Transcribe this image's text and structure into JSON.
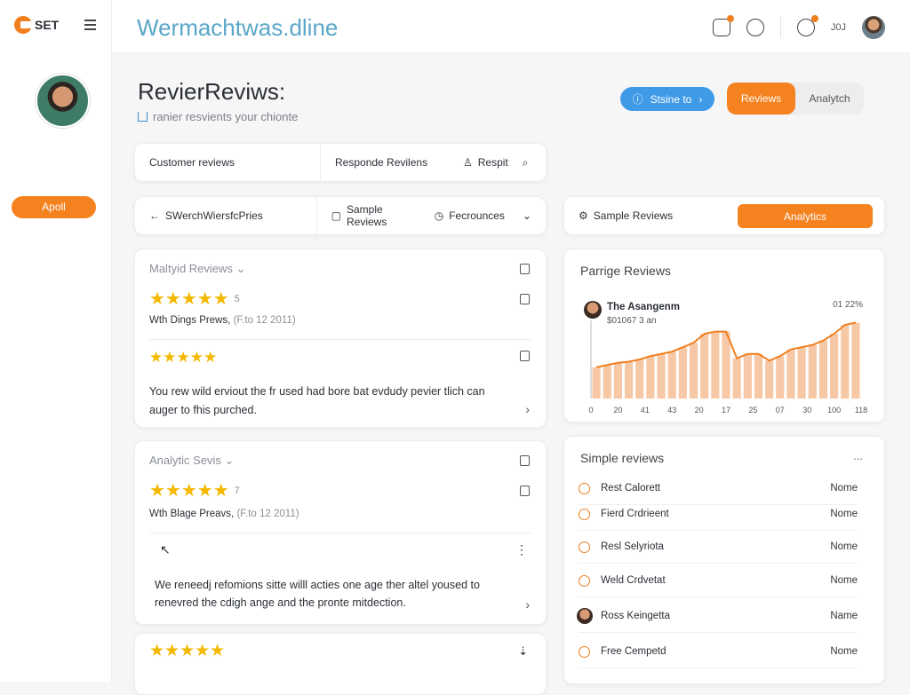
{
  "brand": {
    "logo_text": "SET",
    "site_title": "Wermachtwas.dline"
  },
  "topbar": {
    "user_label": "J0J",
    "icons": [
      "clipboard-icon",
      "link-icon",
      "chat-icon"
    ]
  },
  "sidebar": {
    "button_label": "Apoll"
  },
  "page": {
    "title": "RevierReviws:",
    "subtitle": "ranier resvients your chionte"
  },
  "actions": {
    "primary_pill": "Stsine to",
    "seg_on": "Reviews",
    "seg_off": "Analytch"
  },
  "toolbar1": {
    "a": "Customer reviews",
    "b": "Responde Revilens",
    "c": "Respit"
  },
  "toolbar2": {
    "a": "SWerchWiersfcPries",
    "b": "Sample Reviews",
    "c": "Fecrounces"
  },
  "toolbar3": {
    "a": "Sample Reviews",
    "btn": "Analytics"
  },
  "review1": {
    "heading": "Maltyid Reviews",
    "rating": "5",
    "meta_name": "Wth Dings Prews,",
    "meta_date": "(F.to 12 2011)",
    "body": "You rew wild erviout the fr used had bore bat evdudy pevier tlich can auger to fhis purched."
  },
  "review2": {
    "heading": "Analytic Sevis",
    "rating": "7",
    "meta_name": "Wth Blage Preavs,",
    "meta_date": "(F.to 12 2011)",
    "body": "We reneedj refomions sitte willl acties one age ther altel yoused to renevred the cdigh ange and the pronte mitdection."
  },
  "chart_card": {
    "title": "Parrige Reviews",
    "person": "The Asangenm",
    "figure": "$01067 3 an",
    "corner": "01 22%"
  },
  "chart_data": {
    "type": "bar",
    "title": "Parrige Reviews",
    "x_tick_labels": [
      "0",
      "20",
      "41",
      "43",
      "20",
      "17",
      "25",
      "07",
      "30",
      "100",
      "118"
    ],
    "values": [
      28,
      30,
      32,
      33,
      35,
      38,
      40,
      42,
      46,
      50,
      58,
      60,
      60,
      36,
      40,
      40,
      34,
      38,
      44,
      46,
      48,
      52,
      58,
      66,
      68
    ],
    "line_values": [
      28,
      30,
      32,
      33,
      35,
      38,
      40,
      42,
      46,
      50,
      58,
      60,
      60,
      36,
      40,
      40,
      34,
      38,
      44,
      46,
      48,
      52,
      58,
      66,
      68
    ],
    "colors": {
      "bar": "#f7c8a5",
      "line": "#f07f1f"
    }
  },
  "list": {
    "title": "Simple reviews",
    "more": "...",
    "items": [
      {
        "name": "Rest Calorett",
        "status": "Nome",
        "avatar": false
      },
      {
        "name": "Fierd Crdrieent",
        "status": "Nome",
        "avatar": false
      },
      {
        "name": "Resl Selyriota",
        "status": "Nome",
        "avatar": false
      },
      {
        "name": "Weld Crdvetat",
        "status": "Nome",
        "avatar": false
      },
      {
        "name": "Ross Keingetta",
        "status": "Name",
        "avatar": true
      },
      {
        "name": "Free Cempetd",
        "status": "Nome",
        "avatar": false
      }
    ]
  },
  "colors": {
    "accent": "#f4821f",
    "blue": "#3f9ae8",
    "star": "#f5b800"
  }
}
